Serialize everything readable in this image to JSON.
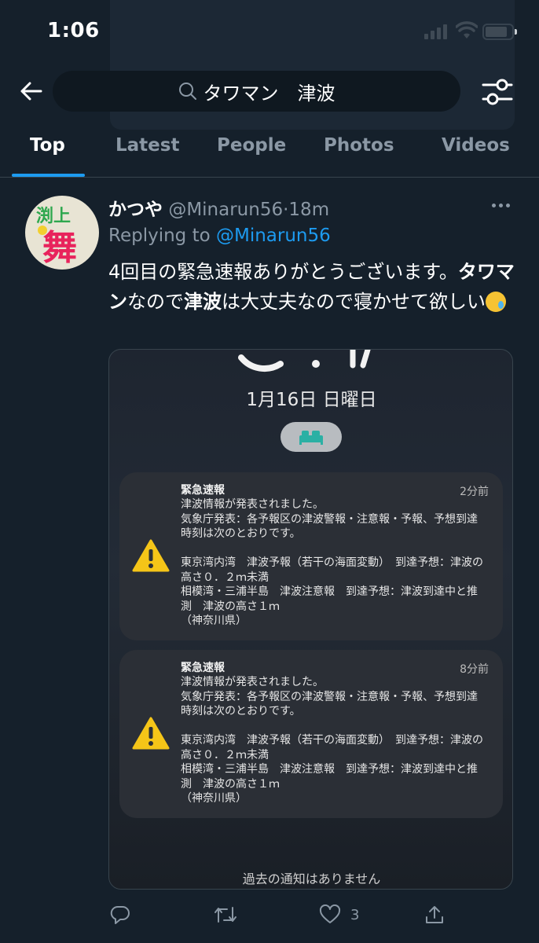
{
  "status": {
    "time": "1:06"
  },
  "search": {
    "query": "タワマン　津波"
  },
  "tabs": [
    {
      "label": "Top"
    },
    {
      "label": "Latest"
    },
    {
      "label": "People"
    },
    {
      "label": "Photos"
    },
    {
      "label": "Videos"
    }
  ],
  "tweet": {
    "avatar_text_top": "渕上",
    "avatar_text_main": "舞",
    "name": "かつや",
    "handle": "@Minarun56",
    "separator": "·",
    "time": "18m",
    "replying_prefix": "Replying to ",
    "replying_to": "@Minarun56",
    "text_1": "4回目の緊急速報ありがとうございます。",
    "text_bold_1": "タワマン",
    "text_2": "なので",
    "text_bold_2": "津波",
    "text_3": "は大丈夫なので寝かせて欲しい",
    "emoji_name": "crying-face-icon",
    "like_count": "3"
  },
  "media": {
    "date": "1月16日 日曜日",
    "notifications": [
      {
        "title": "緊急速報",
        "time": "2分前",
        "body": "津波情報が発表されました。\n気象庁発表：各予報区の津波警報・注意報・予報、予想到達時刻は次のとおりです。\n\n東京湾内湾　津波予報（若干の海面変動）　到達予想：津波の高さ０．２ｍ未満\n相模湾・三浦半島　津波注意報　到達予想：津波到達中と推測　津波の高さ１ｍ\n（神奈川県）"
      },
      {
        "title": "緊急速報",
        "time": "8分前",
        "body": "津波情報が発表されました。\n気象庁発表：各予報区の津波警報・注意報・予報、予想到達時刻は次のとおりです。\n\n東京湾内湾　津波予報（若干の海面変動）　到達予想：津波の高さ０．２ｍ未満\n相模湾・三浦半島　津波注意報　到達予想：津波到達中と推測　津波の高さ１ｍ\n（神奈川県）"
      }
    ],
    "footer": "過去の通知はありません"
  },
  "colors": {
    "background": "#15202b",
    "accent": "#1d9bf0",
    "muted": "#8b98a5",
    "warning": "#f5c518"
  }
}
